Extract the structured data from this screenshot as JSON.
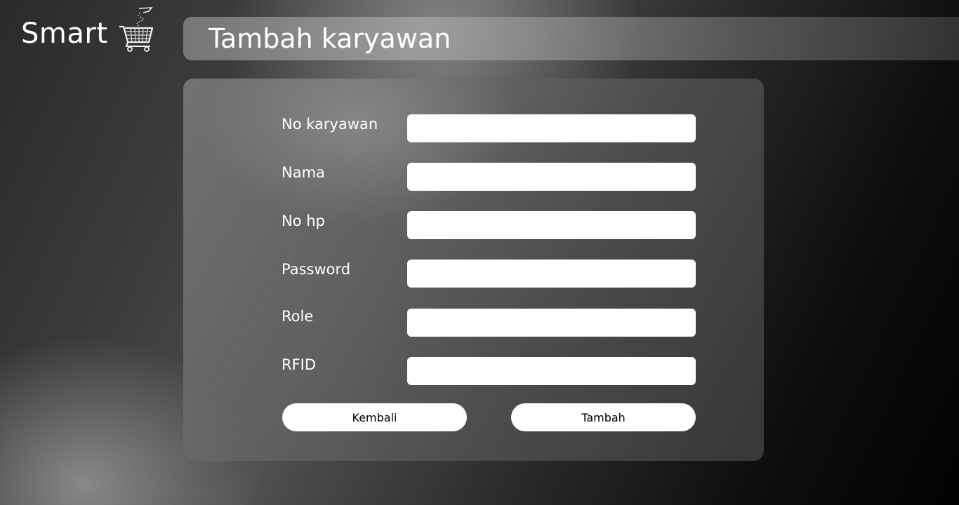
{
  "brand": {
    "name": "Smart",
    "icon": "shopping-cart-icon"
  },
  "header": {
    "title": "Tambah karyawan"
  },
  "form": {
    "fields": [
      {
        "label": "No karyawan",
        "value": "",
        "placeholder": ""
      },
      {
        "label": "Nama",
        "value": "",
        "placeholder": ""
      },
      {
        "label": "No hp",
        "value": "",
        "placeholder": ""
      },
      {
        "label": "Password",
        "value": "",
        "placeholder": ""
      },
      {
        "label": "Role",
        "value": "",
        "placeholder": ""
      },
      {
        "label": "RFID",
        "value": "",
        "placeholder": ""
      }
    ],
    "back_label": "Kembali",
    "submit_label": "Tambah"
  },
  "colors": {
    "text": "#ffffff",
    "input_bg": "#ffffff",
    "button_bg": "#ffffff",
    "button_text": "#000000"
  }
}
